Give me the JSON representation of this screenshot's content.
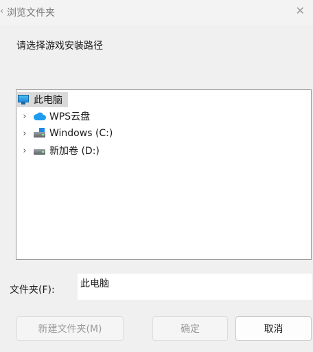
{
  "window": {
    "title": "浏览文件夹",
    "back_glyph": "‹",
    "close_glyph": "✕"
  },
  "prompt": "请选择游戏安装路径",
  "tree": {
    "root": {
      "label": "此电脑",
      "icon": "computer-icon",
      "selected": true
    },
    "items": [
      {
        "label": "WPS云盘",
        "icon": "cloud-icon"
      },
      {
        "label": "Windows (C:)",
        "icon": "system-drive-icon"
      },
      {
        "label": "新加卷 (D:)",
        "icon": "drive-icon"
      }
    ]
  },
  "folder": {
    "label": "文件夹(F):",
    "value": "此电脑"
  },
  "buttons": {
    "new_folder": "新建文件夹(M)",
    "ok": "确定",
    "cancel": "取消"
  },
  "colors": {
    "selection": "#d9d9d9",
    "cloud": "#1f9bf0",
    "background": "#f0f0f0"
  }
}
